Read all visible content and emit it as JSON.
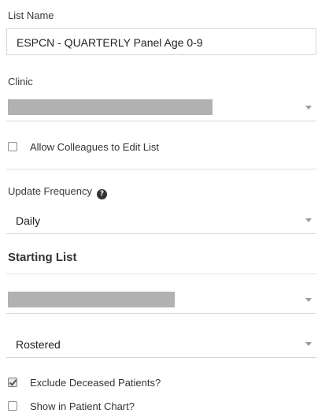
{
  "list_name": {
    "label": "List Name",
    "value": "ESPCN - QUARTERLY Panel Age 0-9"
  },
  "clinic": {
    "label": "Clinic"
  },
  "allow_colleagues": {
    "label": "Allow Colleagues to Edit List",
    "checked": false
  },
  "update_frequency": {
    "label": "Update Frequency",
    "value": "Daily"
  },
  "starting_list": {
    "title": "Starting List",
    "status_value": "Rostered"
  },
  "exclude_deceased": {
    "label": "Exclude Deceased Patients?",
    "checked": true
  },
  "show_in_chart": {
    "label": "Show in Patient Chart?",
    "checked": false
  }
}
